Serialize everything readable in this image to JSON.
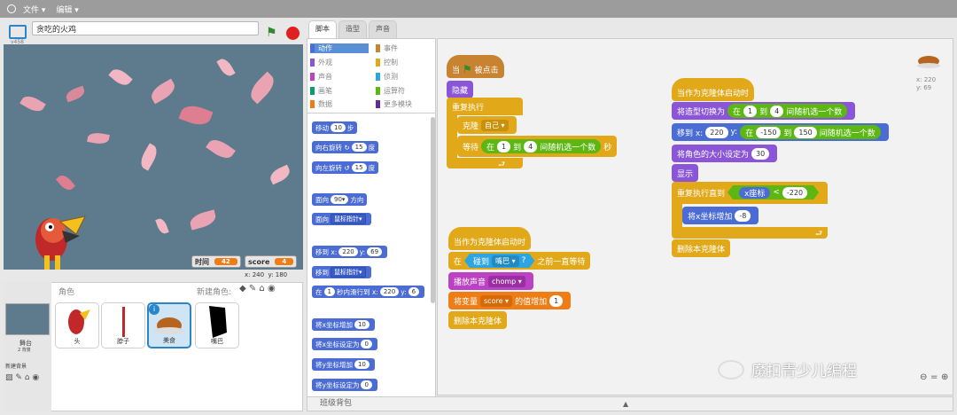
{
  "menu": {
    "file": "文件 ▾",
    "edit": "编辑 ▾"
  },
  "stage": {
    "project_title": "贪吃的火鸡",
    "version": "v458",
    "monitors": [
      {
        "label": "时间",
        "value": "42"
      },
      {
        "label": "score",
        "value": "4"
      }
    ],
    "mouse_x": "x: 240",
    "mouse_y": "y: 180"
  },
  "sprites_pane": {
    "header": "角色",
    "new_sprite": "新建角色:",
    "stage_label": "舞台",
    "stage_backdrops": "2 背景",
    "new_backdrop": "新建背景",
    "sprites": [
      {
        "name": "头"
      },
      {
        "name": "脖子"
      },
      {
        "name": "美食",
        "selected": true
      },
      {
        "name": "嘴巴"
      }
    ]
  },
  "tabs": [
    {
      "label": "脚本",
      "active": true
    },
    {
      "label": "造型"
    },
    {
      "label": "声音"
    }
  ],
  "categories": [
    {
      "label": "动作",
      "color": "#4a6cd4",
      "selected": true
    },
    {
      "label": "事件",
      "color": "#c88330"
    },
    {
      "label": "外观",
      "color": "#8a55d7"
    },
    {
      "label": "控制",
      "color": "#e1a91a"
    },
    {
      "label": "声音",
      "color": "#bb42c3"
    },
    {
      "label": "侦测",
      "color": "#2ca5e2"
    },
    {
      "label": "画笔",
      "color": "#0e9a6c"
    },
    {
      "label": "运算符",
      "color": "#5cb712"
    },
    {
      "label": "数据",
      "color": "#ee7d16"
    },
    {
      "label": "更多模块",
      "color": "#632d99"
    }
  ],
  "palette": {
    "move": "移动",
    "move_steps": "10",
    "move_unit": "步",
    "turn_right": "向右旋转",
    "turn_right_deg": "15",
    "deg": "度",
    "turn_left": "向左旋转",
    "turn_left_deg": "15",
    "point_dir": "面向",
    "point_dir_val": "90▾",
    "point_dir_unit": "方向",
    "point_towards": "面向",
    "point_towards_val": "鼠标指针▾",
    "goto_xy": "移到 x:",
    "goto_x": "220",
    "goto_y_label": "y:",
    "goto_y": "69",
    "goto": "移到",
    "goto_val": "鼠标指针▾",
    "glide_pre": "在",
    "glide_secs": "1",
    "glide_mid": "秒内滑行到 x:",
    "glide_x": "220",
    "glide_y_label": "y:",
    "glide_y": "6",
    "change_x": "将x坐标增加",
    "change_x_val": "10",
    "set_x": "将x坐标设定为",
    "set_x_val": "0",
    "change_y": "将y坐标增加",
    "change_y_val": "10",
    "set_y": "将y坐标设定为",
    "set_y_val": "0"
  },
  "script1": {
    "when": "当",
    "clicked": "被点击",
    "hide": "隐藏",
    "forever": "重复执行",
    "clone": "克隆",
    "clone_target": "自己 ▾",
    "wait": "等待",
    "wait_in": "在",
    "wait_from": "1",
    "wait_to_label": "到",
    "wait_to": "4",
    "wait_random": "间随机选一个数",
    "wait_sec": "秒"
  },
  "script2": {
    "hat": "当作为克隆体启动时",
    "wait_until_pre": "在",
    "touching": "碰到",
    "touching_target": "嘴巴 ▾",
    "q": "?",
    "wait_until_post": "之前一直等待",
    "play_sound": "播放声音",
    "sound_name": "chomp ▾",
    "change_var_pre": "将变量",
    "var_name": "score ▾",
    "change_var_mid": "的值增加",
    "change_var_val": "1",
    "delete": "删除本克隆体"
  },
  "script3": {
    "hat": "当作为克隆体启动时",
    "switch": "将造型切换为",
    "switch_in": "在",
    "switch_from": "1",
    "switch_to_label": "到",
    "switch_to": "4",
    "switch_random": "间随机选一个数",
    "goto_pre": "移到 x:",
    "goto_x": "220",
    "goto_y_label": "y:",
    "goto_y_in": "在",
    "goto_y_from": "-150",
    "goto_y_to_label": "到",
    "goto_y_to": "150",
    "goto_y_random": "间随机选一个数",
    "size": "将角色的大小设定为",
    "size_val": "30",
    "show": "显示",
    "repeat_until": "重复执行直到",
    "xpos": "x座标",
    "lt": "<",
    "lt_val": "-220",
    "change_x": "将x坐标增加",
    "change_x_val": "-8",
    "delete": "删除本克隆体"
  },
  "sprite_info": {
    "x": "x: 220",
    "y": "y: 69"
  },
  "watermark": "魔扣青少儿编程",
  "backpack": "班级背包"
}
